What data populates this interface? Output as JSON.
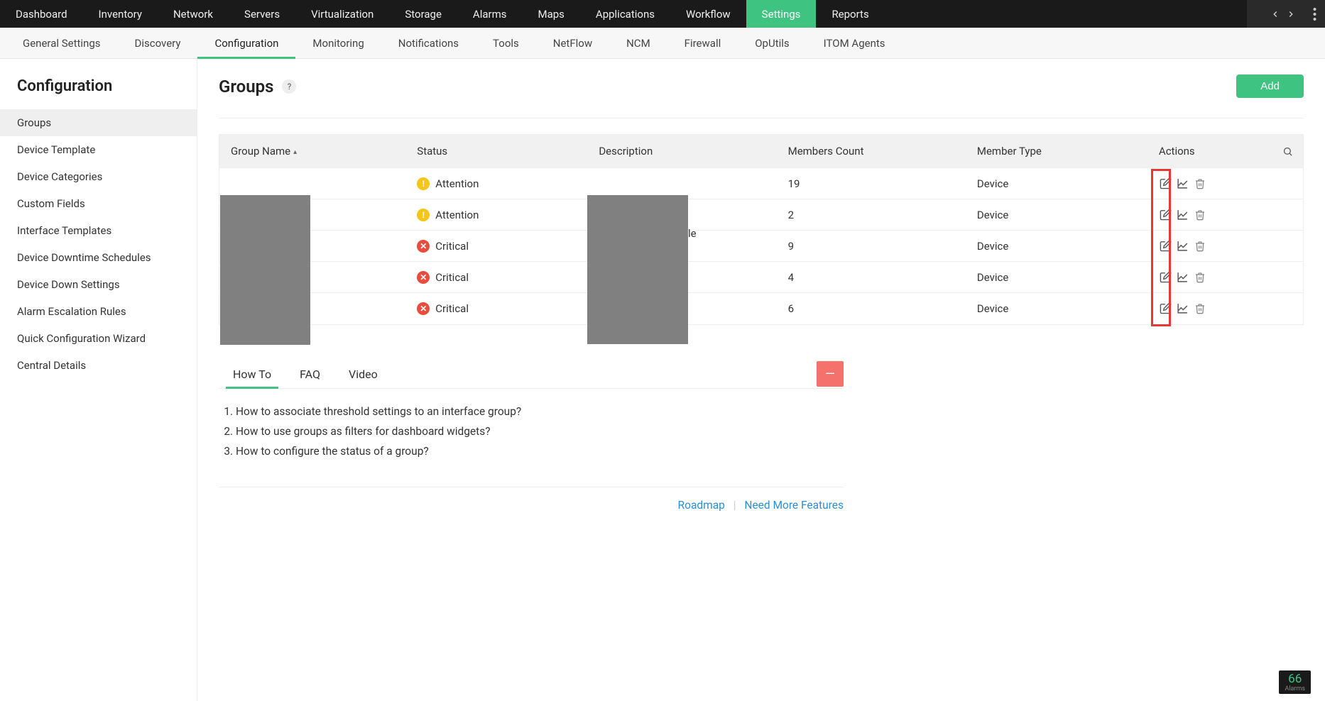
{
  "topnav": {
    "items": [
      "Dashboard",
      "Inventory",
      "Network",
      "Servers",
      "Virtualization",
      "Storage",
      "Alarms",
      "Maps",
      "Applications",
      "Workflow",
      "Settings",
      "Reports"
    ],
    "active_index": 10
  },
  "subnav": {
    "items": [
      "General Settings",
      "Discovery",
      "Configuration",
      "Monitoring",
      "Notifications",
      "Tools",
      "NetFlow",
      "NCM",
      "Firewall",
      "OpUtils",
      "ITOM Agents"
    ],
    "active_index": 2
  },
  "sidebar": {
    "title": "Configuration",
    "items": [
      "Groups",
      "Device Template",
      "Device Categories",
      "Custom Fields",
      "Interface Templates",
      "Device Downtime Schedules",
      "Device Down Settings",
      "Alarm Escalation Rules",
      "Quick Configuration Wizard",
      "Central Details"
    ],
    "active_index": 0
  },
  "page": {
    "title": "Groups",
    "help_badge": "?",
    "add_button": "Add"
  },
  "table": {
    "headers": {
      "group_name": "Group Name",
      "status": "Status",
      "description": "Description",
      "members_count": "Members Count",
      "member_type": "Member Type",
      "actions": "Actions"
    },
    "desc_fragment": "le",
    "rows": [
      {
        "status_type": "warn",
        "status": "Attention",
        "members_count": "19",
        "member_type": "Device"
      },
      {
        "status_type": "warn",
        "status": "Attention",
        "members_count": "2",
        "member_type": "Device"
      },
      {
        "status_type": "crit",
        "status": "Critical",
        "members_count": "9",
        "member_type": "Device"
      },
      {
        "status_type": "crit",
        "status": "Critical",
        "members_count": "4",
        "member_type": "Device"
      },
      {
        "status_type": "crit",
        "status": "Critical",
        "members_count": "6",
        "member_type": "Device"
      }
    ]
  },
  "help": {
    "tabs": [
      "How To",
      "FAQ",
      "Video"
    ],
    "active_tab": 0,
    "items": [
      "How to associate threshold settings to an interface group?",
      "How to use groups as filters for dashboard widgets?",
      "How to configure the status of a group?"
    ],
    "roadmap": "Roadmap",
    "need_more": "Need More Features"
  },
  "alarms": {
    "count": "66",
    "label": "Alarms"
  }
}
